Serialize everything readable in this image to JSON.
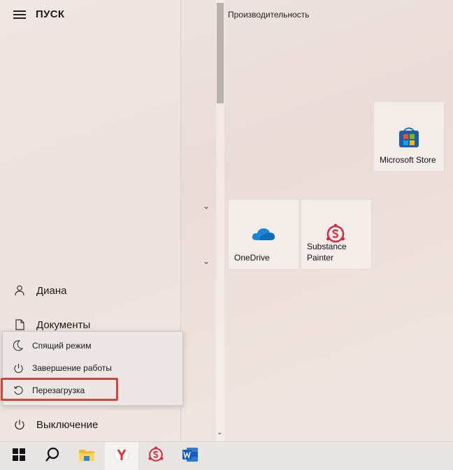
{
  "start": {
    "title": "ПУСК"
  },
  "nav": {
    "user": "Диана",
    "documents": "Документы",
    "power": "Выключение"
  },
  "power_menu": {
    "sleep": "Спящий режим",
    "shutdown": "Завершение работы",
    "restart": "Перезагрузка"
  },
  "tiles_section": {
    "title": "Производительность"
  },
  "tiles": {
    "store": "Microsoft Store",
    "onedrive": "OneDrive",
    "substance_line1": "Substance",
    "substance_line2": "Painter"
  },
  "colors": {
    "highlight": "#d1463f",
    "substance": "#d62b3c",
    "onedrive": "#1c87d8",
    "word": "#185abd"
  },
  "taskbar": {
    "icons": [
      "windows-start-icon",
      "search-icon",
      "file-explorer-icon",
      "yandex-browser-icon",
      "substance-painter-icon",
      "word-icon"
    ]
  }
}
